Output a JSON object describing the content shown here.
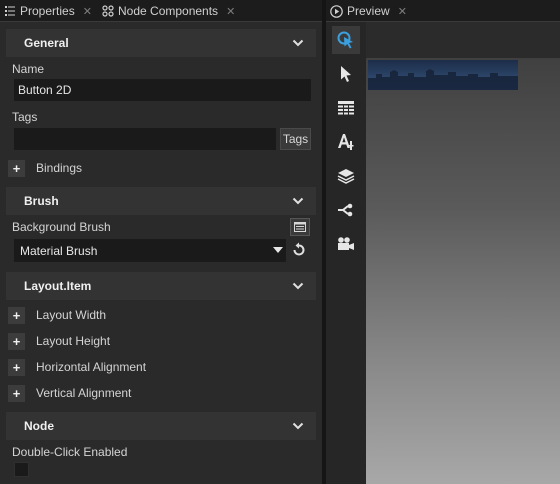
{
  "tabs": [
    {
      "label": "Properties"
    },
    {
      "label": "Node Components"
    }
  ],
  "preview_tab": {
    "label": "Preview"
  },
  "sections": {
    "general": {
      "title": "General"
    },
    "brush": {
      "title": "Brush"
    },
    "layout_item": {
      "title": "Layout.Item"
    },
    "node": {
      "title": "Node"
    }
  },
  "general": {
    "name_label": "Name",
    "name_value": "Button 2D",
    "tags_label": "Tags",
    "tags_value": "",
    "tags_button": "Tags",
    "bindings_label": "Bindings"
  },
  "brush": {
    "background_brush_label": "Background Brush",
    "selected_value": "Material Brush"
  },
  "layout_item": {
    "rows": [
      "Layout Width",
      "Layout Height",
      "Horizontal Alignment",
      "Vertical Alignment"
    ]
  },
  "node": {
    "double_click_label": "Double-Click Enabled",
    "double_click_checked": false
  },
  "toolbar_icons": [
    "interact-tool-icon",
    "select-tool-icon",
    "grid-tool-icon",
    "text-tool-icon",
    "layers-icon",
    "connect-icon",
    "camera-icon"
  ],
  "colors": {
    "accent": "#3aa0e0",
    "panel_bg": "#2a2a2a",
    "section_header_bg": "#333333",
    "field_bg": "#1a1a1a"
  }
}
